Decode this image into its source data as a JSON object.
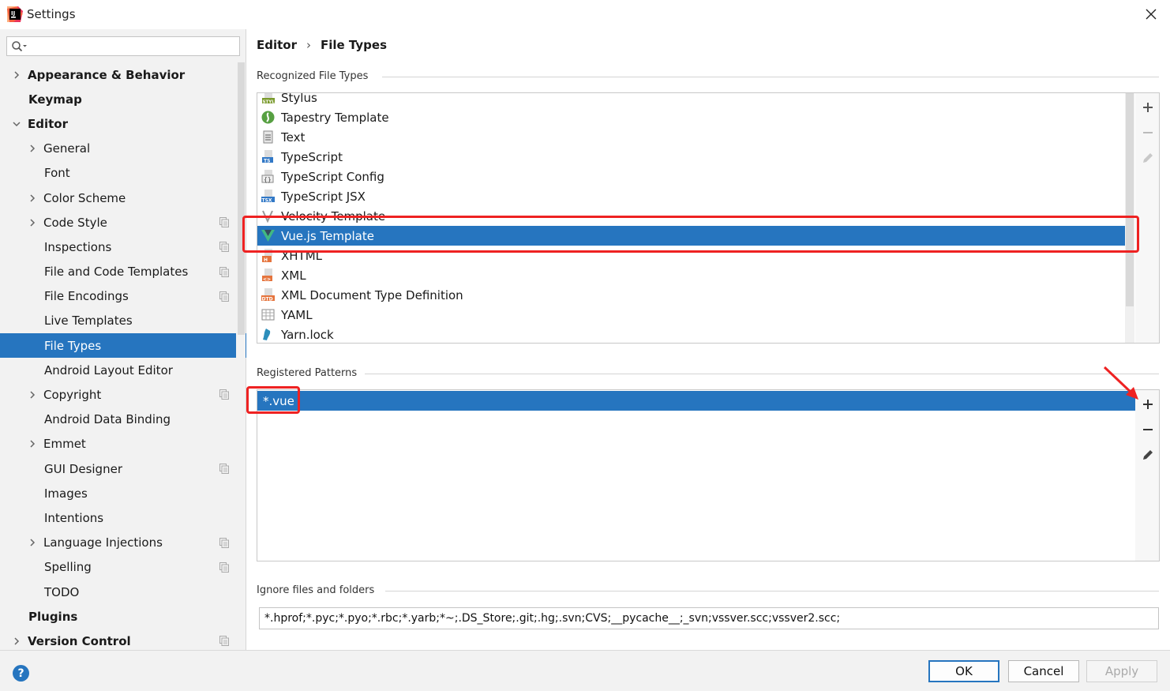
{
  "window": {
    "title": "Settings",
    "app_icon": "intellij-icon",
    "close_icon": "close-icon"
  },
  "search": {
    "placeholder": "",
    "value": ""
  },
  "sidebar": {
    "items": [
      {
        "label": "Appearance & Behavior",
        "level": 0,
        "expandable": true,
        "expanded": false,
        "bold": true,
        "project": false
      },
      {
        "label": "Keymap",
        "level": 0,
        "expandable": false,
        "bold": true,
        "project": false
      },
      {
        "label": "Editor",
        "level": 0,
        "expandable": true,
        "expanded": true,
        "bold": true,
        "project": false
      },
      {
        "label": "General",
        "level": 1,
        "expandable": true,
        "expanded": false,
        "project": false
      },
      {
        "label": "Font",
        "level": 1,
        "expandable": false,
        "project": false
      },
      {
        "label": "Color Scheme",
        "level": 1,
        "expandable": true,
        "expanded": false,
        "project": false
      },
      {
        "label": "Code Style",
        "level": 1,
        "expandable": true,
        "expanded": false,
        "project": true
      },
      {
        "label": "Inspections",
        "level": 1,
        "expandable": false,
        "project": true
      },
      {
        "label": "File and Code Templates",
        "level": 1,
        "expandable": false,
        "project": true
      },
      {
        "label": "File Encodings",
        "level": 1,
        "expandable": false,
        "project": true
      },
      {
        "label": "Live Templates",
        "level": 1,
        "expandable": false,
        "project": false
      },
      {
        "label": "File Types",
        "level": 1,
        "expandable": false,
        "project": false,
        "selected": true
      },
      {
        "label": "Android Layout Editor",
        "level": 1,
        "expandable": false,
        "project": false
      },
      {
        "label": "Copyright",
        "level": 1,
        "expandable": true,
        "expanded": false,
        "project": true
      },
      {
        "label": "Android Data Binding",
        "level": 1,
        "expandable": false,
        "project": false
      },
      {
        "label": "Emmet",
        "level": 1,
        "expandable": true,
        "expanded": false,
        "project": false
      },
      {
        "label": "GUI Designer",
        "level": 1,
        "expandable": false,
        "project": true
      },
      {
        "label": "Images",
        "level": 1,
        "expandable": false,
        "project": false
      },
      {
        "label": "Intentions",
        "level": 1,
        "expandable": false,
        "project": false
      },
      {
        "label": "Language Injections",
        "level": 1,
        "expandable": true,
        "expanded": false,
        "project": true
      },
      {
        "label": "Spelling",
        "level": 1,
        "expandable": false,
        "project": true
      },
      {
        "label": "TODO",
        "level": 1,
        "expandable": false,
        "project": false
      },
      {
        "label": "Plugins",
        "level": 0,
        "expandable": false,
        "bold": true,
        "project": false
      },
      {
        "label": "Version Control",
        "level": 0,
        "expandable": true,
        "expanded": false,
        "bold": true,
        "project": true
      }
    ]
  },
  "breadcrumb": {
    "parent": "Editor",
    "separator": "›",
    "current": "File Types"
  },
  "recognized": {
    "title": "Recognized File Types",
    "items": [
      {
        "label": "Stylus",
        "icon": "stylus-icon"
      },
      {
        "label": "Tapestry Template",
        "icon": "tapestry-icon"
      },
      {
        "label": "Text",
        "icon": "text-file-icon"
      },
      {
        "label": "TypeScript",
        "icon": "typescript-icon"
      },
      {
        "label": "TypeScript Config",
        "icon": "typescript-config-icon"
      },
      {
        "label": "TypeScript JSX",
        "icon": "typescript-jsx-icon"
      },
      {
        "label": "Velocity Template",
        "icon": "velocity-icon"
      },
      {
        "label": "Vue.js Template",
        "icon": "vue-icon",
        "selected": true
      },
      {
        "label": "XHTML",
        "icon": "xhtml-icon"
      },
      {
        "label": "XML",
        "icon": "xml-icon"
      },
      {
        "label": "XML Document Type Definition",
        "icon": "dtd-icon"
      },
      {
        "label": "YAML",
        "icon": "yaml-icon"
      },
      {
        "label": "Yarn.lock",
        "icon": "yarn-icon"
      }
    ],
    "toolbar": {
      "add": "plus-icon",
      "remove": "minus-icon",
      "edit": "pencil-icon"
    }
  },
  "patterns": {
    "title": "Registered Patterns",
    "items": [
      {
        "label": "*.vue",
        "selected": true
      }
    ],
    "toolbar": {
      "add": "plus-icon",
      "remove": "minus-icon",
      "edit": "pencil-icon"
    }
  },
  "ignore": {
    "title": "Ignore files and folders",
    "value": "*.hprof;*.pyc;*.pyo;*.rbc;*.yarb;*~;.DS_Store;.git;.hg;.svn;CVS;__pycache__;_svn;vssver.scc;vssver2.scc;"
  },
  "footer": {
    "help": "?",
    "ok": "OK",
    "cancel": "Cancel",
    "apply": "Apply"
  },
  "colors": {
    "selection": "#2675bf",
    "annotation_red": "#ee2222",
    "sidebar_bg": "#f2f2f2"
  }
}
